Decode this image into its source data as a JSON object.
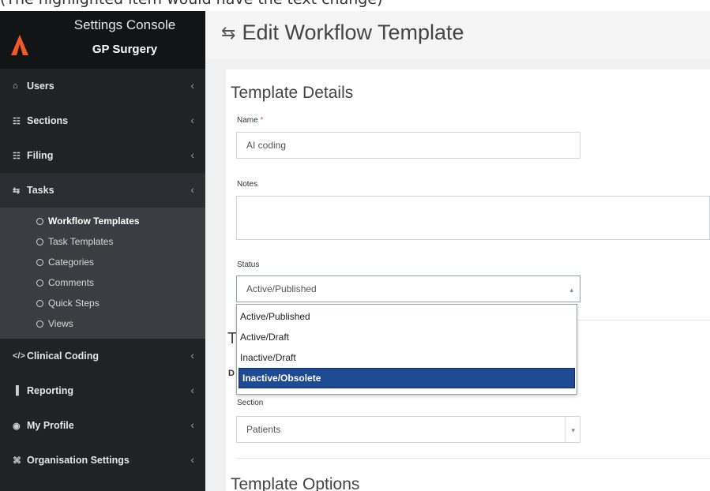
{
  "caption": "(The highlighted item would have the text change)",
  "sidebar": {
    "title": "Settings Console",
    "subtitle": "GP Surgery",
    "items": [
      {
        "icon": "user-icon",
        "glyph": "⌂",
        "label": "Users"
      },
      {
        "icon": "sections-icon",
        "glyph": "☷",
        "label": "Sections"
      },
      {
        "icon": "filing-icon",
        "glyph": "☷",
        "label": "Filing"
      },
      {
        "icon": "tasks-icon",
        "glyph": "⇆",
        "label": "Tasks"
      },
      {
        "icon": "code-icon",
        "glyph": "</>",
        "label": "Clinical Coding"
      },
      {
        "icon": "chart-icon",
        "glyph": "▐",
        "label": "Reporting"
      },
      {
        "icon": "profile-icon",
        "glyph": "◉",
        "label": "My Profile"
      },
      {
        "icon": "org-icon",
        "glyph": "⌘",
        "label": "Organisation Settings"
      }
    ],
    "tasks_sub": [
      "Workflow Templates",
      "Task Templates",
      "Categories",
      "Comments",
      "Quick Steps",
      "Views"
    ]
  },
  "page": {
    "title": "Edit Workflow Template"
  },
  "form": {
    "section_details": "Template Details",
    "name_label": "Name",
    "name_required": "*",
    "name_value": "AI coding",
    "notes_label": "Notes",
    "notes_value": "",
    "status_label": "Status",
    "status_value": "Active/Published",
    "status_options": [
      "Active/Published",
      "Active/Draft",
      "Inactive/Draft",
      "Inactive/Obsolete"
    ],
    "partial_heading": "T",
    "partial_label": "D",
    "section_label": "Section",
    "section_value": "Patients",
    "section_options": "Template Options"
  },
  "colors": {
    "sidebar": "#1f2326",
    "brand": "#121416",
    "accent": "#f05a28",
    "selected": "#1e4a94"
  }
}
